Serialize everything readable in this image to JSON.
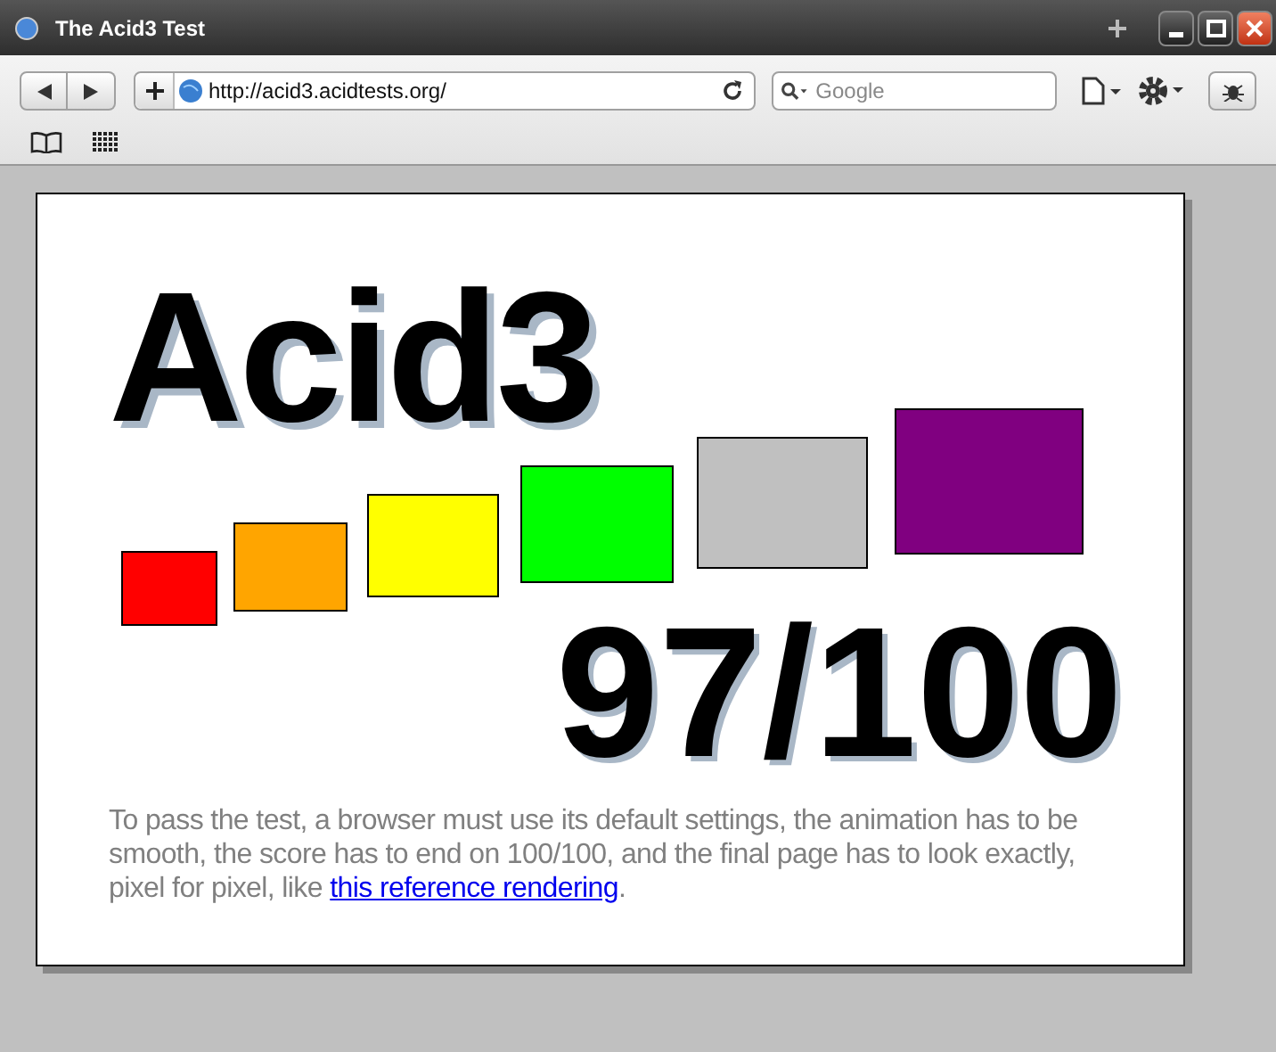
{
  "window": {
    "title": "The Acid3 Test"
  },
  "toolbar": {
    "url": "http://acid3.acidtests.org/",
    "search": {
      "placeholder": "Google"
    }
  },
  "page": {
    "heading": "Acid3",
    "squares": [
      {
        "color": "#ff0000"
      },
      {
        "color": "#ffa500"
      },
      {
        "color": "#ffff00"
      },
      {
        "color": "#00ff00"
      },
      {
        "color": "#c0c0c0"
      },
      {
        "color": "#800080"
      }
    ],
    "score": "97/100",
    "text": "To pass the test, a browser must use its default settings, the animation has to be smooth, the score has to end on 100/100, and the final page has to look exactly, pixel for pixel, like",
    "link": "this reference rendering",
    "text_end": "."
  }
}
